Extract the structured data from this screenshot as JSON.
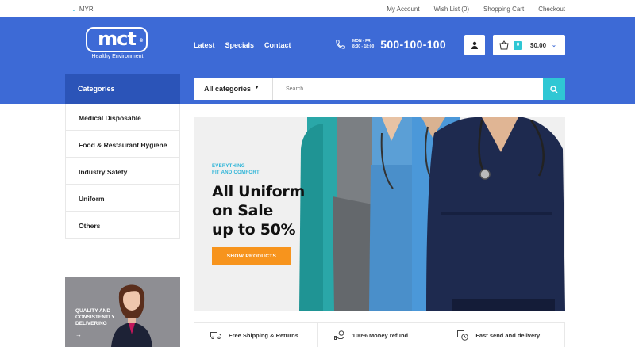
{
  "topbar": {
    "currency": "MYR",
    "links": [
      "My Account",
      "Wish List (0)",
      "Shopping Cart",
      "Checkout"
    ]
  },
  "brand": {
    "logo_text": "mct",
    "tagline": "Healthy Environment"
  },
  "nav": {
    "items": [
      "Latest",
      "Specials",
      "Contact"
    ]
  },
  "phone": {
    "hours_line1": "MON - FRI",
    "hours_line2": "8:30 - 18:00",
    "number": "500-100-100"
  },
  "cart": {
    "count": "0",
    "total": "$0.00"
  },
  "categories": {
    "heading": "Categories",
    "items": [
      "Medical Disposable",
      "Food & Restaurant Hygiene",
      "Industry Safety",
      "Uniform",
      "Others"
    ]
  },
  "search": {
    "category_selected": "All categories",
    "placeholder": "Search..."
  },
  "promo": {
    "line1": "QUALITY AND",
    "line2": "CONSISTENTLY",
    "line3": "DELIVERING"
  },
  "hero": {
    "eyebrow_line1": "EVERYTHING",
    "eyebrow_line2": "FIT AND COMFORT",
    "headline_line1": "All Uniform",
    "headline_line2": "on Sale",
    "headline_line3": "up to 50%",
    "cta": "SHOW PRODUCTS"
  },
  "features": [
    "Free Shipping & Returns",
    "100% Money refund",
    "Fast send and delivery"
  ],
  "colors": {
    "header_blue": "#3d6ad6",
    "accent_cyan": "#2fc7d4",
    "cta_orange": "#f7941d"
  }
}
